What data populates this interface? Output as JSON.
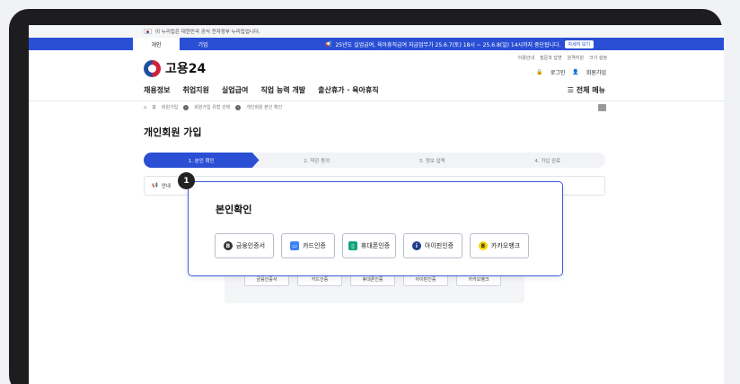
{
  "gov_banner": {
    "text": "이 누리집은 대한민국 공식 전자정부 누리집입니다."
  },
  "tabs": {
    "personal": "개인",
    "business": "기업"
  },
  "notice": {
    "text": "25년도 실업급여, 육아휴직급여 지급업무가 25.6.7(토) 18시 ~ 25.6.8(일) 14시까지 중단됩니다.",
    "button": "자세히 보기"
  },
  "util_links": [
    "이용안내",
    "질문과 답변",
    "원격지원",
    "크기 설정"
  ],
  "header": {
    "logo": "고용24",
    "login": "로그인",
    "signup": "회원가입"
  },
  "gnb": {
    "items": [
      "채용정보",
      "취업지원",
      "실업급여",
      "직업 능력 개발",
      "출산휴가 · 육아휴직"
    ],
    "all_menu": "전체 메뉴"
  },
  "breadcrumb": [
    "홈",
    "회원가입",
    "회원가입 유형 선택",
    "개인회원 본인 확인"
  ],
  "page_title": "개인회원 가입",
  "steps": [
    "1. 본인 확인",
    "2. 약관 동의",
    "3. 정보 입력",
    "4. 가입 완료"
  ],
  "guide": {
    "label": "안내"
  },
  "annotation_number": "1",
  "popup": {
    "title": "본인확인",
    "methods": [
      "금융인증서",
      "카드인증",
      "휴대폰인증",
      "아이핀인증",
      "카카오뱅크"
    ]
  },
  "colors": {
    "primary": "#2a4fd4",
    "popup_border": "#3b5bdb",
    "kakao": "#f7d400"
  }
}
